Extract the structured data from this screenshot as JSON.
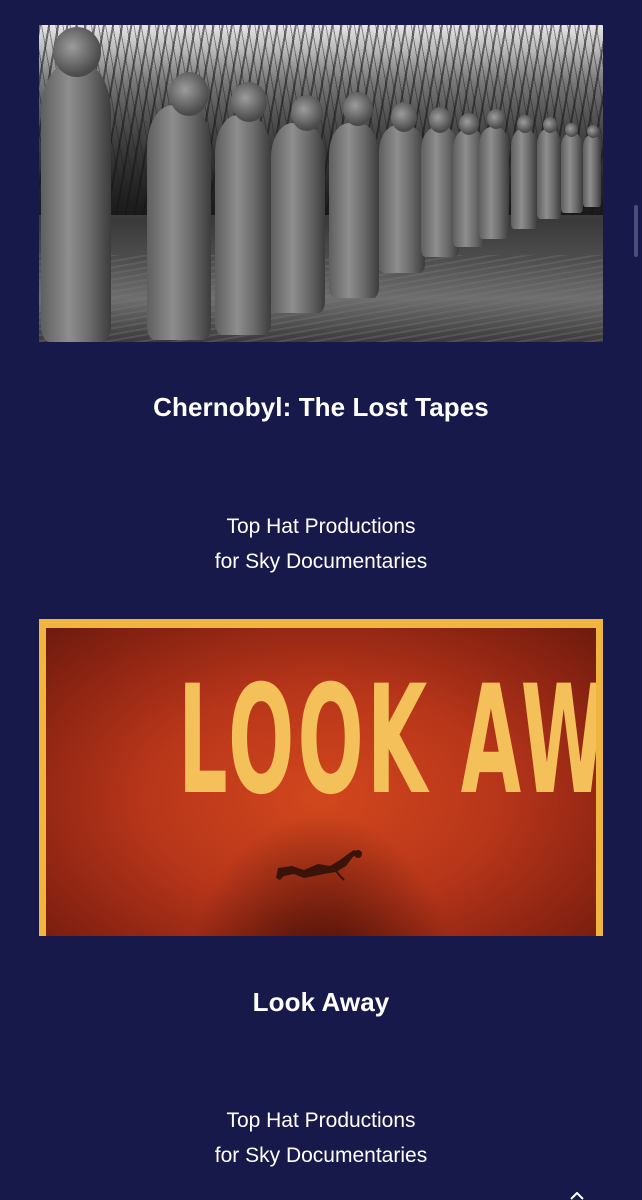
{
  "cards": [
    {
      "title": "Chernobyl: The Lost Tapes",
      "subtitle_line1": "Top Hat Productions",
      "subtitle_line2": "for Sky Documentaries",
      "image": "chernobyl-workers-photo"
    },
    {
      "title": "Look Away",
      "subtitle_line1": "Top Hat Productions",
      "subtitle_line2": "for Sky Documentaries",
      "image": "look-away-poster",
      "poster_text": "LOOK AWAY"
    }
  ],
  "colors": {
    "background": "#17194a",
    "text": "#ffffff",
    "poster_border": "#f0b53f",
    "poster_text": "#f3c05a",
    "poster_red": "#c23f1b"
  }
}
